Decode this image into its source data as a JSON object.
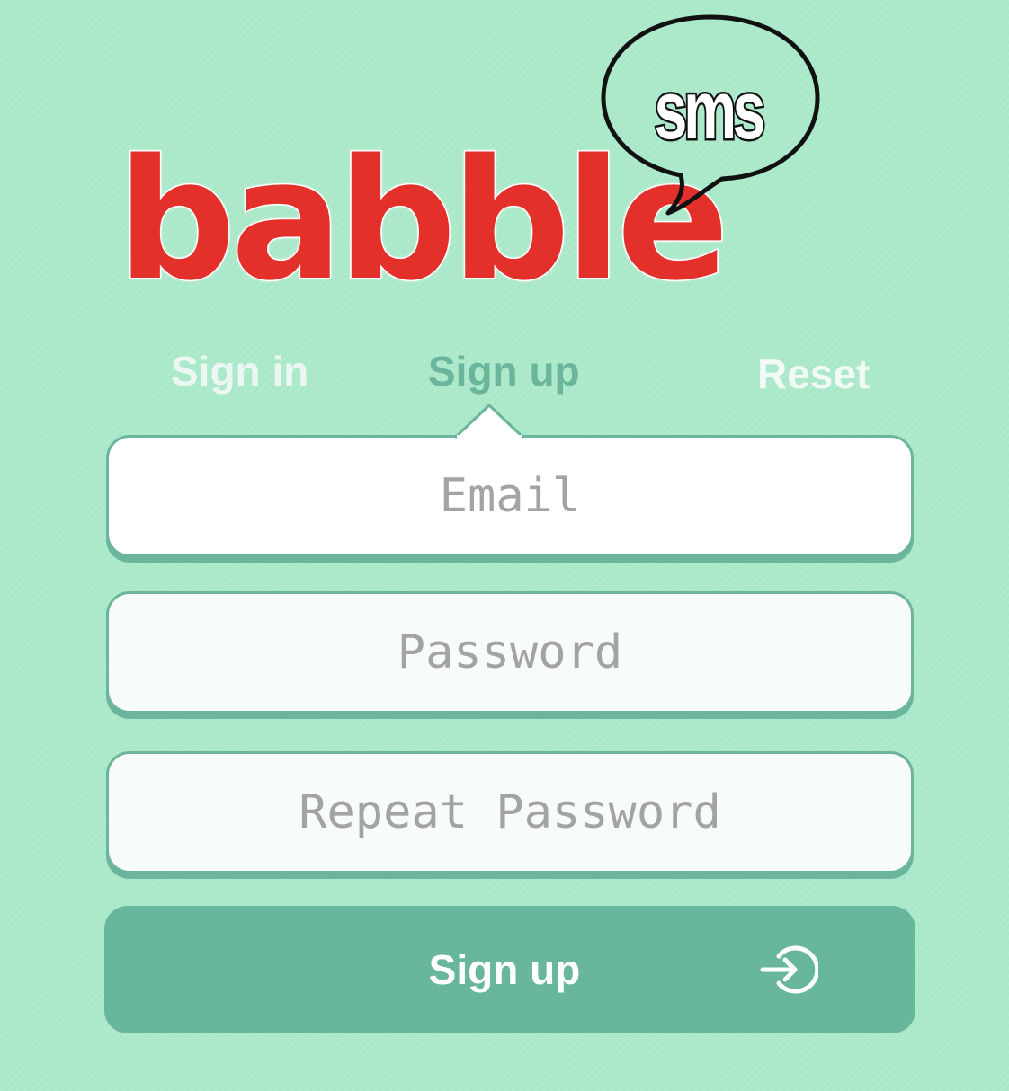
{
  "app": {
    "logo_word": "babble",
    "logo_badge": "sms",
    "brand_colors": {
      "logo_red": "#e3302a",
      "background": "#a9e8c8",
      "accent": "#68b79c"
    }
  },
  "tabs": [
    {
      "label": "Sign in",
      "active": false
    },
    {
      "label": "Sign up",
      "active": true
    },
    {
      "label": "Reset",
      "active": false
    }
  ],
  "form": {
    "email": {
      "value": "",
      "placeholder": "Email"
    },
    "password": {
      "value": "",
      "placeholder": "Password"
    },
    "repeat_password": {
      "value": "",
      "placeholder": "Repeat Password"
    },
    "submit_label": "Sign up",
    "submit_icon": "sign-in-arrow-icon"
  }
}
